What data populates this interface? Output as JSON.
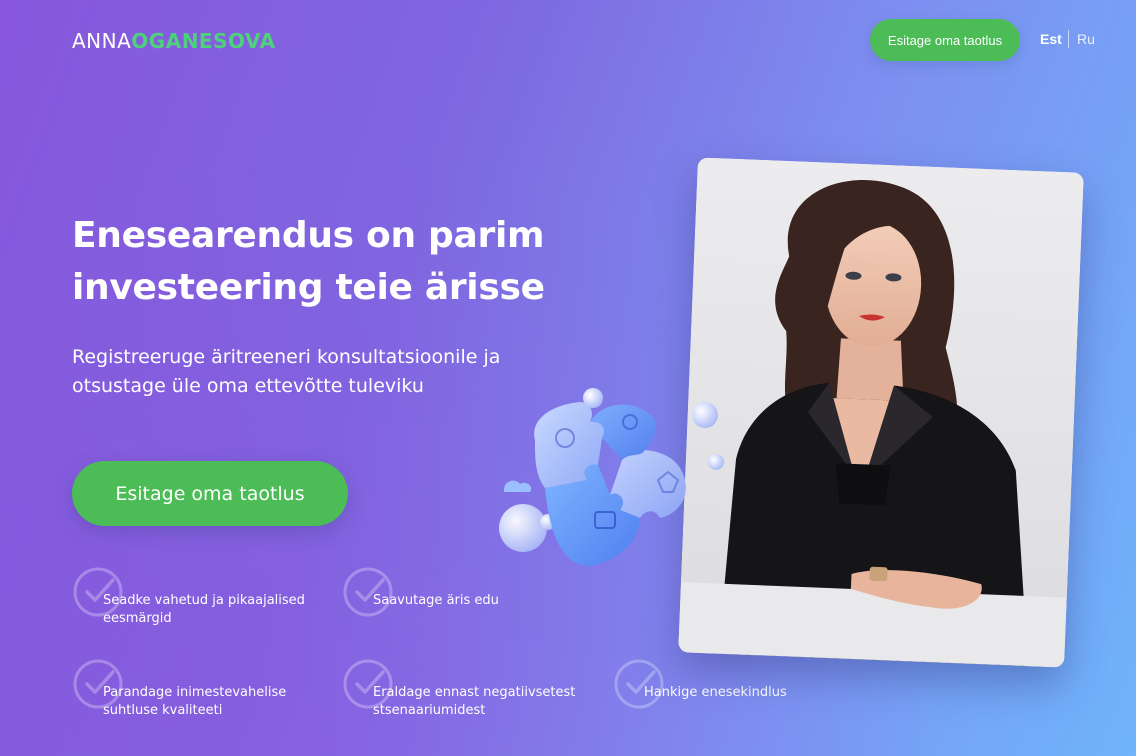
{
  "brand": {
    "first": "ANNA",
    "last": "OGANESOVA",
    "colors": {
      "first": "#ffffff",
      "last": "#4fd07a"
    }
  },
  "header": {
    "cta_label": "Esitage oma taotlus",
    "languages": [
      {
        "code": "Est",
        "active": true
      },
      {
        "code": "Ru",
        "active": false
      }
    ]
  },
  "hero": {
    "title_line1": "Enesearendus on parim",
    "title_line2": "investeering teie ärisse",
    "subtitle_line1": "Registreeruge äritreeneri konsultatsioonile ja",
    "subtitle_line2": "otsustage üle oma ettevõtte tuleviku",
    "cta_label": "Esitage oma taotlus"
  },
  "benefits": [
    {
      "line1": "Seadke vahetud ja pikaajalised",
      "line2": "eesmärgid",
      "icon": "check-circle-icon"
    },
    {
      "line1": "Saavutage äris edu",
      "line2": "",
      "icon": "check-circle-icon"
    },
    {
      "line1": "Parandage inimestevahelise",
      "line2": "suhtluse kvaliteeti",
      "icon": "check-circle-icon"
    },
    {
      "line1": "Eraldage ennast negatiivsetest",
      "line2": "stsenaariumidest",
      "icon": "check-circle-icon"
    },
    {
      "line1": "Hankige enesekindlus",
      "line2": "",
      "icon": "check-circle-icon"
    }
  ],
  "colors": {
    "accent_green": "#4cbc57",
    "gradient_start": "#8756dc",
    "gradient_end": "#6fb4fc"
  }
}
